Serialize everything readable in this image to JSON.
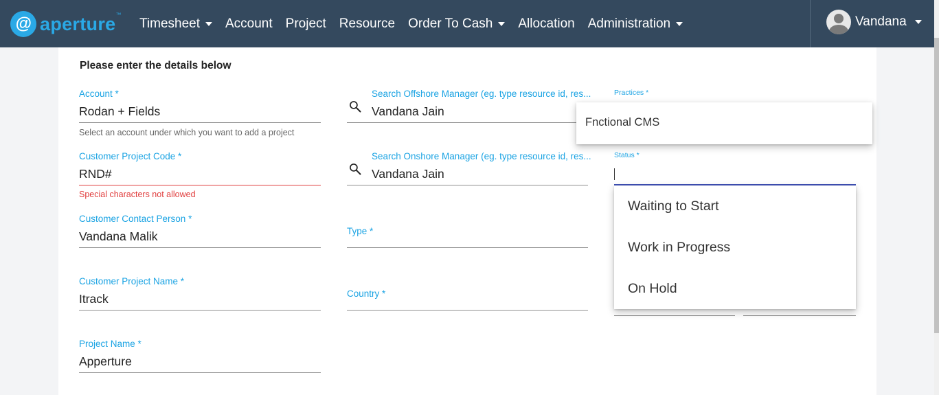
{
  "brand": {
    "logo_glyph": "@",
    "name": "aperture",
    "tm": "™"
  },
  "nav": {
    "items": [
      {
        "label": "Timesheet",
        "dropdown": true
      },
      {
        "label": "Account",
        "dropdown": false
      },
      {
        "label": "Project",
        "dropdown": false
      },
      {
        "label": "Resource",
        "dropdown": false
      },
      {
        "label": "Order To Cash",
        "dropdown": true
      },
      {
        "label": "Allocation",
        "dropdown": false
      },
      {
        "label": "Administration",
        "dropdown": true
      }
    ],
    "user_name": "Vandana"
  },
  "form": {
    "heading": "Please enter the details below",
    "account": {
      "label": "Account *",
      "value": "Rodan + Fields",
      "hint": "Select an account under which you want to add a project"
    },
    "customer_project_code": {
      "label": "Customer Project Code *",
      "value": "RND#",
      "error": "Special characters not allowed"
    },
    "customer_contact_person": {
      "label": "Customer Contact Person *",
      "value": "Vandana Malik"
    },
    "customer_project_name": {
      "label": "Customer Project Name *",
      "value": "Itrack"
    },
    "project_name": {
      "label": "Project Name *",
      "value": "Apperture"
    },
    "offshore_manager": {
      "label": "Search Offshore Manager (eg. type resource id, res...",
      "value": "Vandana Jain"
    },
    "onshore_manager": {
      "label": "Search Onshore Manager (eg. type resource id, res...",
      "value": "Vandana Jain"
    },
    "type": {
      "label": "Type *"
    },
    "country": {
      "label": "Country *"
    },
    "practices": {
      "label": "Practices *",
      "option": "Fnctional CMS"
    },
    "status": {
      "label": "Status *",
      "options": [
        "Waiting to Start",
        "Work in Progress",
        "On Hold"
      ]
    }
  },
  "colors": {
    "navbar": "#34495e",
    "accent": "#1aa3e3",
    "error": "#e03c3c",
    "focus": "#3f51b5"
  }
}
